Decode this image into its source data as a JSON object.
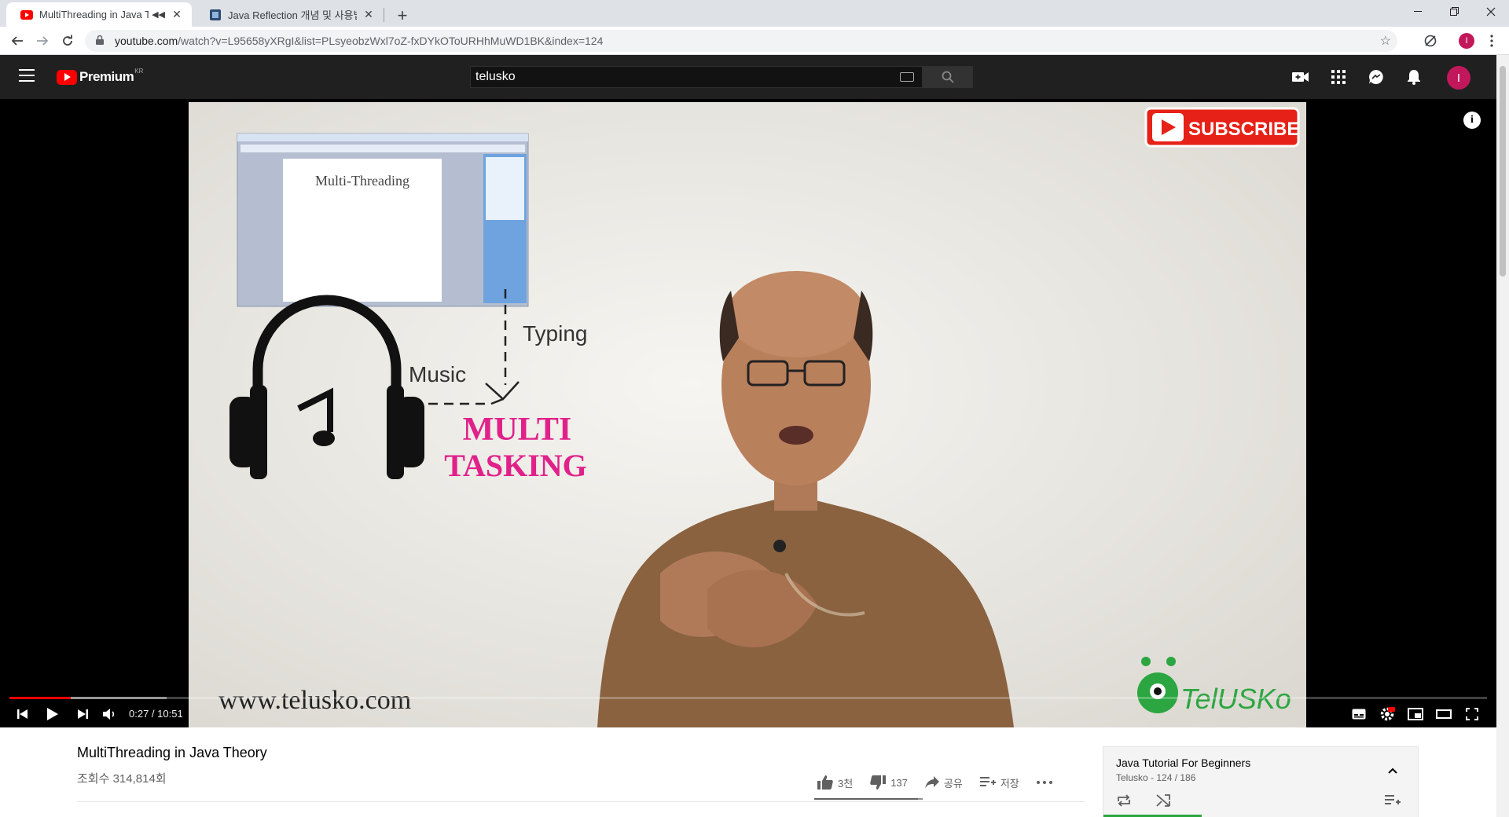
{
  "browser": {
    "tabs": [
      {
        "title": "MultiThreading in Java The",
        "active": true,
        "muted": true
      },
      {
        "title": "Java Reflection 개념 및 사용법",
        "active": false
      }
    ],
    "url_host": "youtube.com",
    "url_path": "/watch?v=L95658yXRgI&list=PLsyeobzWxl7oZ-fxDYkOToURHhMuWD1BK&index=124",
    "profile_initial": "I"
  },
  "youtube": {
    "logo_text": "Premium",
    "logo_region": "KR",
    "search_value": "telusko",
    "avatar_initial": "I"
  },
  "player": {
    "current_time": "0:27",
    "duration": "10:51",
    "time_separator": " / ",
    "progress": 0.0414,
    "video_content": {
      "subscribe_text": "SUBSCRIBE",
      "doc_title": "Multi-Threading",
      "label_typing": "Typing",
      "label_music": "Music",
      "label_multi": "MULTI",
      "label_tasking": "TASKING",
      "website": "www.telusko.com",
      "brand": "TelUSKo"
    }
  },
  "video": {
    "title": "MultiThreading in Java Theory",
    "views": "조회수 314,814회",
    "likes": "3천",
    "dislikes": "137",
    "share_label": "공유",
    "save_label": "저장",
    "like_ratio": 0.956
  },
  "playlist": {
    "title": "Java Tutorial For Beginners",
    "subtitle": "Telusko - 124 / 186"
  },
  "colors": {
    "yt_red": "#ff0000",
    "masthead": "#202020",
    "magenta": "#e0218a",
    "shirt": "#8a6240",
    "progress_green": "#2ba640"
  }
}
